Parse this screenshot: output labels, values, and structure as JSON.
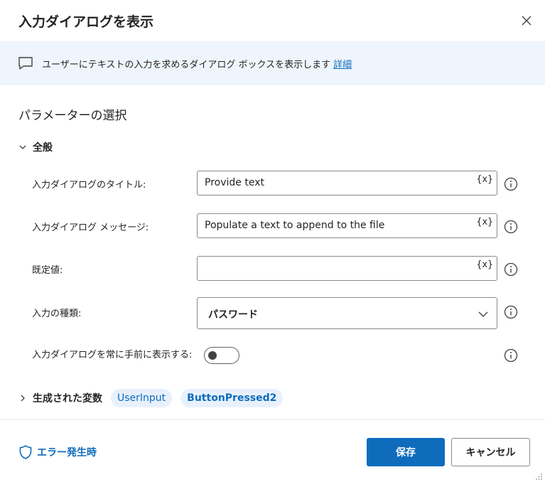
{
  "dialog": {
    "title": "入力ダイアログを表示",
    "info_text": "ユーザーにテキストの入力を求めるダイアログ ボックスを表示します",
    "info_link": "詳細"
  },
  "params": {
    "section_title": "パラメーターの選択",
    "group_label": "全般",
    "var_symbol": "{x}",
    "fields": [
      {
        "label": "入力ダイアログのタイトル:",
        "value": "Provide text"
      },
      {
        "label": "入力ダイアログ メッセージ:",
        "value": "Populate a text to append to the file"
      },
      {
        "label": "既定値:",
        "value": ""
      }
    ],
    "input_type": {
      "label": "入力の種類:",
      "value": "パスワード"
    },
    "topmost": {
      "label": "入力ダイアログを常に手前に表示する:",
      "on": false
    }
  },
  "generated_vars": {
    "label": "生成された変数",
    "vars": [
      "UserInput",
      "ButtonPressed2"
    ]
  },
  "footer": {
    "on_error": "エラー発生時",
    "save": "保存",
    "cancel": "キャンセル"
  },
  "colors": {
    "accent": "#0f6cbd",
    "info_bg": "#eff5fc",
    "chip_bg": "#e8f1fb"
  }
}
